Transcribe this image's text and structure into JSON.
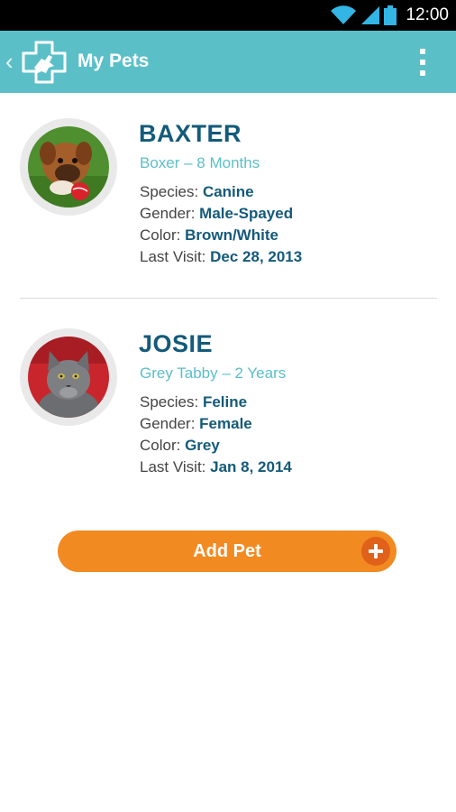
{
  "status_bar": {
    "time": "12:00",
    "icons": [
      "wifi-icon",
      "signal-icon",
      "battery-icon"
    ]
  },
  "app_bar": {
    "title": "My Pets",
    "back_icon": "chevron-left-icon",
    "logo_icon": "pet-cross-logo-icon",
    "menu_icon": "overflow-menu-icon"
  },
  "pets": [
    {
      "name": "BAXTER",
      "breed_age": "Boxer – 8 Months",
      "species_label": "Species: ",
      "species": "Canine",
      "gender_label": "Gender: ",
      "gender": "Male-Spayed",
      "color_label": "Color: ",
      "color": "Brown/White",
      "visit_label": "Last Visit: ",
      "last_visit": "Dec 28, 2013"
    },
    {
      "name": "JOSIE",
      "breed_age": "Grey Tabby – 2 Years",
      "species_label": "Species: ",
      "species": "Feline",
      "gender_label": "Gender: ",
      "gender": "Female",
      "color_label": "Color: ",
      "color": "Grey",
      "visit_label": "Last Visit: ",
      "last_visit": "Jan 8, 2014"
    }
  ],
  "add_button": {
    "label": "Add Pet",
    "icon": "plus-circle-icon"
  },
  "colors": {
    "app_bar": "#5bbfc8",
    "accent_text": "#145a7a",
    "subtitle": "#5bbfc8",
    "button": "#f28a22",
    "button_icon": "#e0611a"
  }
}
